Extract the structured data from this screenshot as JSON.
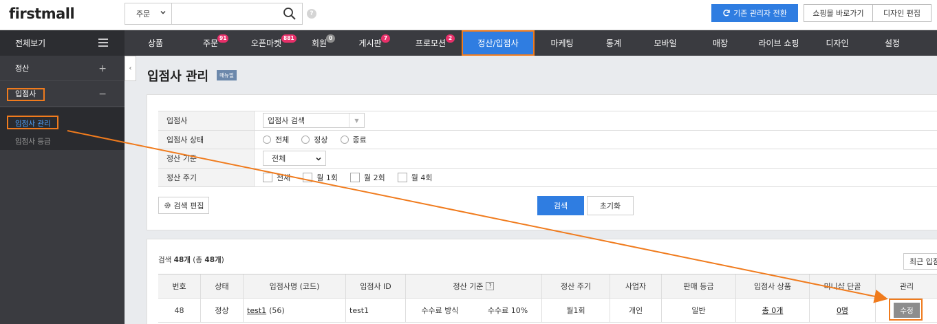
{
  "header": {
    "logo": "firstmall",
    "search_select": "주문",
    "search_placeholder": "",
    "help": "?",
    "switch_admin_label": "기존 관리자 전환",
    "shop_link_label": "쇼핑몰 바로가기",
    "design_edit_label": "디자인 편집"
  },
  "nav": {
    "all_label": "전체보기",
    "items": [
      {
        "label": "상품",
        "badge": ""
      },
      {
        "label": "주문",
        "badge": "91"
      },
      {
        "label": "오픈마켓",
        "badge": "881"
      },
      {
        "label": "회원",
        "badge": "0"
      },
      {
        "label": "게시판",
        "badge": "7"
      },
      {
        "label": "프로모션",
        "badge": "2"
      },
      {
        "label": "정산/입점사",
        "badge": ""
      },
      {
        "label": "마케팅",
        "badge": ""
      },
      {
        "label": "통계",
        "badge": ""
      },
      {
        "label": "모바일",
        "badge": ""
      },
      {
        "label": "매장",
        "badge": ""
      },
      {
        "label": "라이브 쇼핑",
        "badge": ""
      },
      {
        "label": "디자인",
        "badge": ""
      },
      {
        "label": "설정",
        "badge": ""
      }
    ],
    "badge_colors": {
      "pink": "#e8306a",
      "gray": "#8e8e8e"
    }
  },
  "sidebar": {
    "sections": [
      {
        "label": "정산",
        "toggle": "+"
      },
      {
        "label": "입점사",
        "toggle": "−"
      }
    ],
    "sub_items": [
      {
        "label": "입점사 관리"
      },
      {
        "label": "입점사 등급"
      }
    ],
    "collapse": "‹"
  },
  "page": {
    "title": "입점사 관리",
    "manual_badge": "매뉴얼"
  },
  "filters": {
    "rows": [
      {
        "label": "입점사"
      },
      {
        "label": "입점사 상태"
      },
      {
        "label": "정산 기준"
      },
      {
        "label": "정산 주기"
      }
    ],
    "seller_select_placeholder": "입점사 검색",
    "status_options": [
      "전체",
      "정상",
      "종료"
    ],
    "basis_select": "전체",
    "cycle_options": [
      "전체",
      "월 1회",
      "월 2회",
      "월 4회"
    ],
    "edit_button": "검색 편집",
    "search_button": "검색",
    "reset_button": "초기화"
  },
  "results": {
    "summary_prefix": "검색 ",
    "summary_count": "48개",
    "summary_mid": " (총 ",
    "summary_total": "48개",
    "summary_suffix": ")",
    "recent_button": "최근 입점",
    "headers": [
      "번호",
      "상태",
      "입점사명 (코드)",
      "입점사 ID",
      "정산 기준",
      "정산 주기",
      "사업자",
      "판매 등급",
      "입점사 상품",
      "미니샵 단골",
      "관리"
    ],
    "header_help": "?",
    "row": {
      "no": "48",
      "status": "정상",
      "name": "test1",
      "code": "(56)",
      "id": "test1",
      "basis_type": "수수료 방식",
      "basis_value": "수수료 10%",
      "cycle": "월1회",
      "biz": "개인",
      "grade": "일반",
      "products": "총 0개",
      "followers": "0명",
      "action": "수정"
    }
  },
  "annotation_color": "#f07b1d",
  "accent_color": "#2f7de1"
}
